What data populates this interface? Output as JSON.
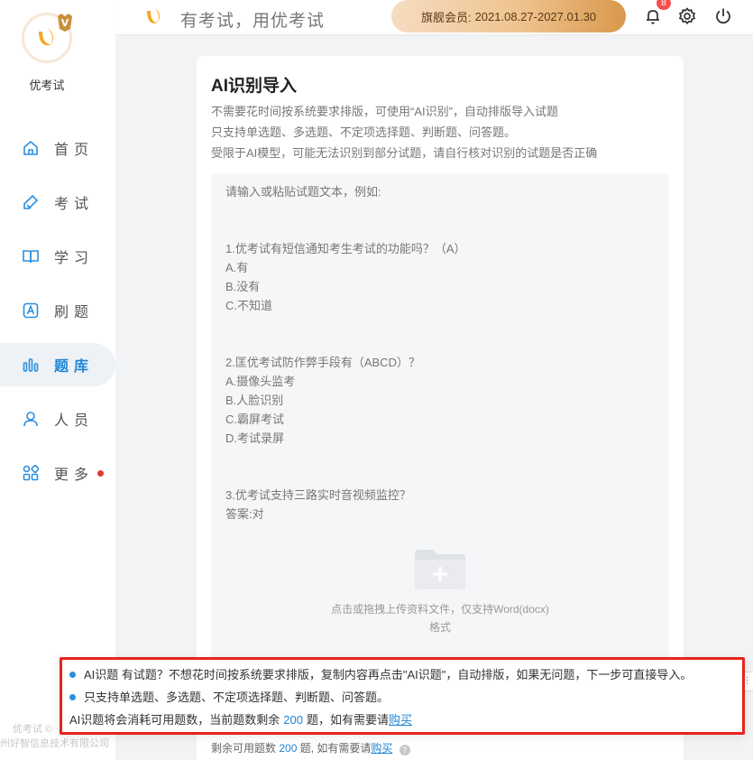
{
  "brand": {
    "name": "优考试",
    "vip_letter": "V"
  },
  "nav": [
    {
      "label": "首页",
      "icon": "home-icon"
    },
    {
      "label": "考试",
      "icon": "pencil-icon"
    },
    {
      "label": "学习",
      "icon": "book-icon"
    },
    {
      "label": "刷题",
      "icon": "letter-a-icon"
    },
    {
      "label": "题库",
      "icon": "bar-chart-icon",
      "active": true
    },
    {
      "label": "人员",
      "icon": "person-icon"
    },
    {
      "label": "更多",
      "icon": "apps-icon",
      "dot": true
    }
  ],
  "header": {
    "slogan": "有考试，用优考试",
    "member_label": "旗舰会员:",
    "member_period": "2021.08.27-2027.01.30",
    "notification_count": "8"
  },
  "card": {
    "title": "AI识别导入",
    "desc": [
      "不需要花时间按系统要求排版，可使用“AI识别”，自动排版导入试题",
      "只支持单选题、多选题、不定项选择题、判断题、问答题。",
      "受限于AI模型，可能无法识别到部分试题，请自行核对识别的试题是否正确"
    ],
    "editor_placeholder": "请输入或粘贴试题文本，例如:\n\n\n1.优考试有短信通知考生考试的功能吗？（A）\nA.有\nB.没有\nC.不知道\n\n\n2.匡优考试防作弊手段有（ABCD）？\nA.摄像头监考\nB.人脸识别\nC.霸屏考试\nD.考试录屏\n\n\n3.优考试支持三路实时音视频监控？\n答案:对",
    "upload_line1": "点击或拖拽上传资料文件，仅支持Word(docx)",
    "upload_line2": "格式",
    "footer_prefix": "剩余可用题数",
    "footer_count": "200",
    "footer_mid": "题, 如有需要请",
    "footer_link": "购买"
  },
  "tip": {
    "line1": "AI识题 有试题？不想花时间按系统要求排版，复制内容再点击\"AI识题\"，自动排版，如果无问题，下一步可直接导入。",
    "line2": "只支持单选题、多选题、不定项选择题、判断题、问答题。",
    "line3_prefix": "AI识题将会消耗可用题数，当前题数剩余",
    "line3_count": "200",
    "line3_mid": "题，如有需要请",
    "line3_link": "购买",
    "side_tab": "⋮"
  },
  "copyright": {
    "line1": "优考试 ©",
    "line2": "州好智信息技术有限公司"
  },
  "colors": {
    "accent": "#1f86d6",
    "highlight": "#e8231e",
    "brand_orange": "#f5a623"
  }
}
